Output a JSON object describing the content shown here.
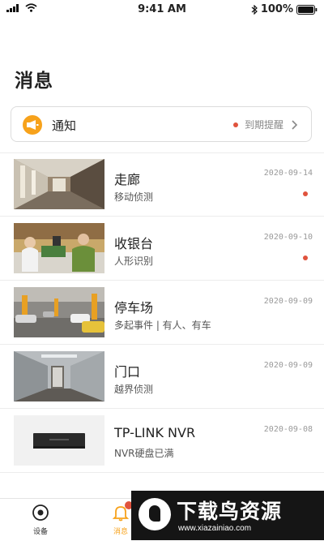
{
  "status_bar": {
    "time": "9:41 AM",
    "battery": "100%"
  },
  "page_title": "消息",
  "notice": {
    "label": "通知",
    "action": "到期提醒",
    "icon": "megaphone-icon"
  },
  "messages": [
    {
      "title": "走廊",
      "subtitle": "移动侦测",
      "date": "2020-09-14",
      "unread": true,
      "thumb": "corridor"
    },
    {
      "title": "收银台",
      "subtitle": "人形识别",
      "date": "2020-09-10",
      "unread": true,
      "thumb": "checkout"
    },
    {
      "title": "停车场",
      "subtitle": "多起事件 | 有人、有车",
      "date": "2020-09-09",
      "unread": false,
      "thumb": "parking"
    },
    {
      "title": "门口",
      "subtitle": "越界侦测",
      "date": "2020-09-09",
      "unread": false,
      "thumb": "doorway"
    },
    {
      "title": "TP-LINK NVR",
      "subtitle": "NVR硬盘已满",
      "date": "2020-09-08",
      "unread": false,
      "thumb": "nvr-device"
    }
  ],
  "tabbar": {
    "devices": "设备",
    "messages": "消息"
  },
  "watermark": {
    "title": "下载鸟资源",
    "url": "www.xiazainiao.com"
  },
  "colors": {
    "accent": "#f7a21b",
    "unread": "#e0533d"
  }
}
